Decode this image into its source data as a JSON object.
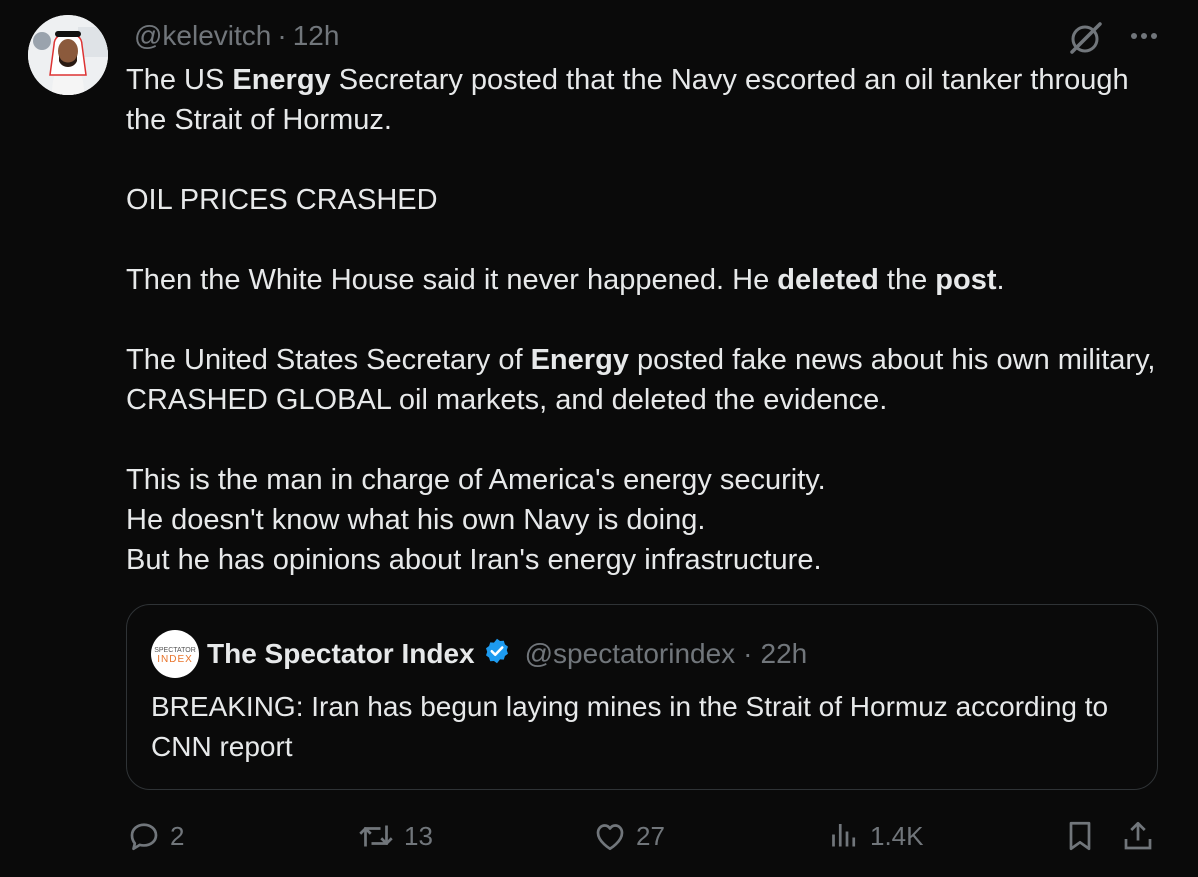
{
  "author": {
    "handle": "@kelevitch",
    "separator": "·",
    "time": "12h",
    "avatar_icon": "profile-photo"
  },
  "tweet": {
    "p1": {
      "a": "The US ",
      "b": "Energy",
      "c": " Secretary posted that the Navy escorted an oil tanker through the Strait of Hormuz."
    },
    "p2": "OIL PRICES CRASHED",
    "p3": {
      "a": "Then the White House said it never happened. He ",
      "b": "deleted",
      "c": " the ",
      "d": "post",
      "e": "."
    },
    "p4": {
      "a": "The United States Secretary of ",
      "b": "Energy",
      "c": " posted fake news about his own military, CRASHED GLOBAL oil markets, and deleted the evidence."
    },
    "p5": {
      "line1": "This is the man in charge of America's energy security.",
      "line2": "He doesn't know what his own Navy is doing.",
      "line3": "But he has opinions about Iran's energy infrastructure."
    }
  },
  "quote": {
    "avatar_text_top": "SPECTATOR",
    "avatar_text_bottom": "INDEX",
    "name": "The Spectator Index",
    "verified_icon": "verified-badge-icon",
    "handle": "@spectatorindex",
    "separator": "·",
    "time": "22h",
    "text": "BREAKING: Iran has begun laying mines in the Strait of Hormuz according to CNN report"
  },
  "actions": {
    "replies": "2",
    "reposts": "13",
    "likes": "27",
    "views": "1.4K"
  },
  "colors": {
    "background": "#0a0a0a",
    "text": "#e7e9ea",
    "secondary": "#71767b",
    "border": "#2f3336",
    "verified": "#1d9bf0",
    "brand_orange": "#e8732a"
  }
}
